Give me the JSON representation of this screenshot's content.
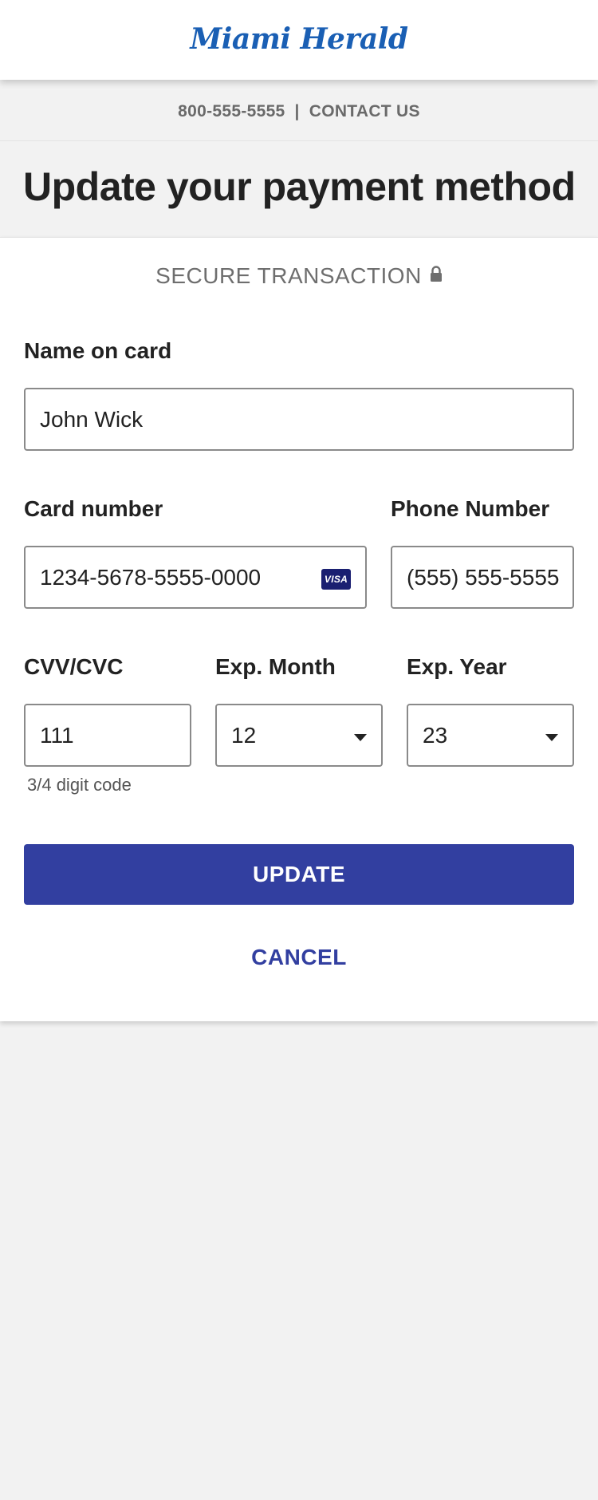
{
  "header": {
    "logo_text": "Miami Herald"
  },
  "contact": {
    "phone": "800-555-5555",
    "separator": "|",
    "link": "CONTACT US"
  },
  "page": {
    "title": "Update your payment method"
  },
  "secure": {
    "text": "SECURE TRANSACTION",
    "icon": "lock-icon"
  },
  "form": {
    "name": {
      "label": "Name on card",
      "value": "John Wick"
    },
    "card_number": {
      "label": "Card number",
      "value": "1234-5678-5555-0000",
      "brand": "VISA"
    },
    "phone": {
      "label": "Phone Number",
      "value": "(555) 555-5555"
    },
    "cvv": {
      "label": "CVV/CVC",
      "value": "111",
      "hint": "3/4 digit code"
    },
    "exp_month": {
      "label": "Exp. Month",
      "value": "12"
    },
    "exp_year": {
      "label": "Exp. Year",
      "value": "23"
    }
  },
  "actions": {
    "update": "UPDATE",
    "cancel": "CANCEL"
  },
  "colors": {
    "brand_blue": "#1a5fb4",
    "button": "#323fa0",
    "page_bg": "#f2f2f2",
    "visa_bg": "#1a1f71"
  }
}
